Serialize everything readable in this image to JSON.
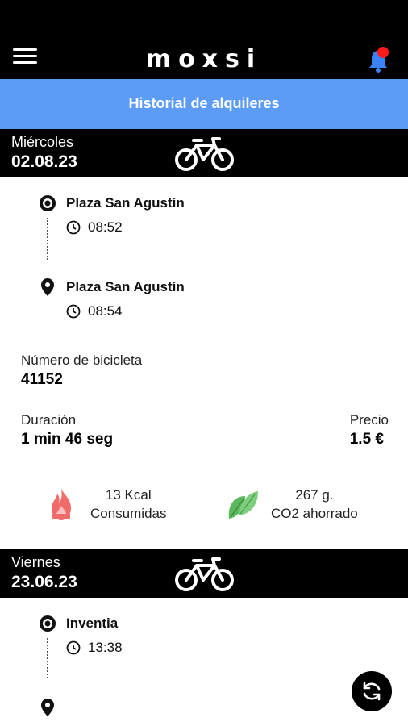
{
  "app": {
    "logo": "moxsi"
  },
  "page": {
    "title": "Historial de alquileres"
  },
  "rentals": [
    {
      "day_name": "Miércoles",
      "date": "02.08.23",
      "origin": {
        "station": "Plaza San Agustín",
        "time": "08:52"
      },
      "destination": {
        "station": "Plaza San Agustín",
        "time": "08:54"
      },
      "bike_number_label": "Número de bicicleta",
      "bike_number": "41152",
      "duration_label": "Duración",
      "duration": "1 min 46 seg",
      "price_label": "Precio",
      "price": "1.5 €",
      "kcal_value": "13 Kcal",
      "kcal_label": "Consumidas",
      "co2_value": "267 g.",
      "co2_label": "CO2 ahorrado"
    },
    {
      "day_name": "Viernes",
      "date": "23.06.23",
      "origin": {
        "station": "Inventia",
        "time": "13:38"
      }
    }
  ],
  "icons": {
    "menu": "hamburger-menu-icon",
    "notifications": "bell-icon",
    "bike": "bicycle-icon",
    "origin": "target-icon",
    "destination": "map-pin-icon",
    "time": "clock-icon",
    "calories": "flame-icon",
    "co2": "leaf-icon",
    "refresh": "refresh-icon"
  },
  "colors": {
    "accent": "#5c9cf7",
    "header": "#000000",
    "notification": "#ff1a1a",
    "bell": "#3b82f6",
    "flame": "#f26b6b",
    "leaf": "#5cb85c"
  }
}
